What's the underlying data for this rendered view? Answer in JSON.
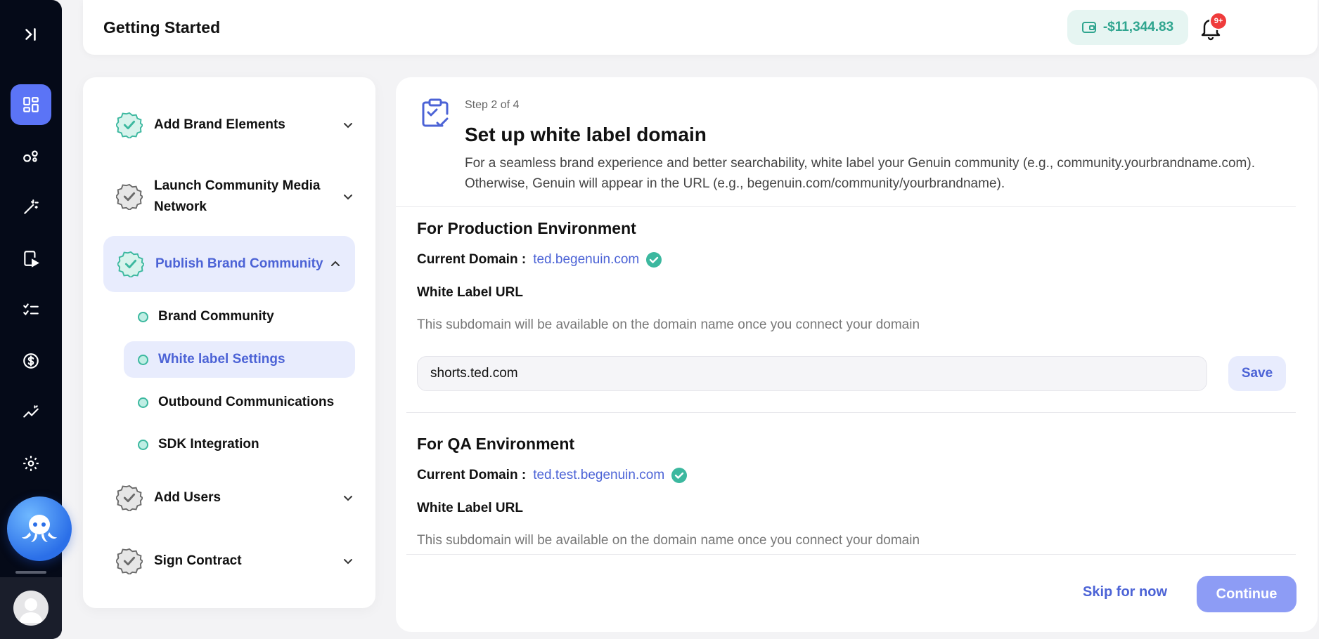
{
  "header": {
    "title": "Getting Started",
    "wallet_balance": "-$11,344.83",
    "notification_badge": "9+"
  },
  "rail": {
    "items": [
      {
        "name": "collapse-icon"
      },
      {
        "name": "dashboard-icon",
        "active": true
      },
      {
        "name": "community-icon"
      },
      {
        "name": "magic-wand-icon"
      },
      {
        "name": "video-icon"
      },
      {
        "name": "checklist-icon"
      },
      {
        "name": "dollar-icon"
      },
      {
        "name": "analytics-icon"
      },
      {
        "name": "settings-icon"
      }
    ]
  },
  "steps": {
    "items": [
      {
        "label": "Add Brand Elements",
        "completed": true,
        "expanded": false
      },
      {
        "label": "Launch Community Media Network",
        "completed": false,
        "expanded": false
      },
      {
        "label": "Publish Brand Community",
        "completed": true,
        "expanded": true
      },
      {
        "label": "Add Users",
        "completed": false,
        "expanded": false
      },
      {
        "label": "Sign Contract",
        "completed": false,
        "expanded": false
      }
    ],
    "subitems": [
      {
        "label": "Brand Community"
      },
      {
        "label": "White label Settings",
        "active": true
      },
      {
        "label": "Outbound Communications"
      },
      {
        "label": "SDK Integration"
      }
    ]
  },
  "main": {
    "step_count": "Step 2 of 4",
    "title": "Set up white label domain",
    "description": "For a seamless brand experience and better searchability, white label your Genuin community (e.g., community.yourbrandname.com). Otherwise, Genuin will appear in the URL (e.g., begenuin.com/community/yourbrandname).",
    "production": {
      "title": "For Production Environment",
      "current_domain_label": "Current Domain :",
      "current_domain": "ted.begenuin.com",
      "white_label_label": "White Label URL",
      "help_text": "This subdomain will be available on the domain name once you connect your domain",
      "url_value": "shorts.ted.com",
      "save_label": "Save"
    },
    "qa": {
      "title": "For QA Environment",
      "current_domain_label": "Current Domain :",
      "current_domain": "ted.test.begenuin.com",
      "white_label_label": "White Label URL",
      "help_text": "This subdomain will be available on the domain name once you connect your domain"
    },
    "skip_label": "Skip for now",
    "continue_label": "Continue"
  },
  "colors": {
    "accent": "#5b74f6",
    "teal": "#3cb89f",
    "rail": "#050a18"
  }
}
